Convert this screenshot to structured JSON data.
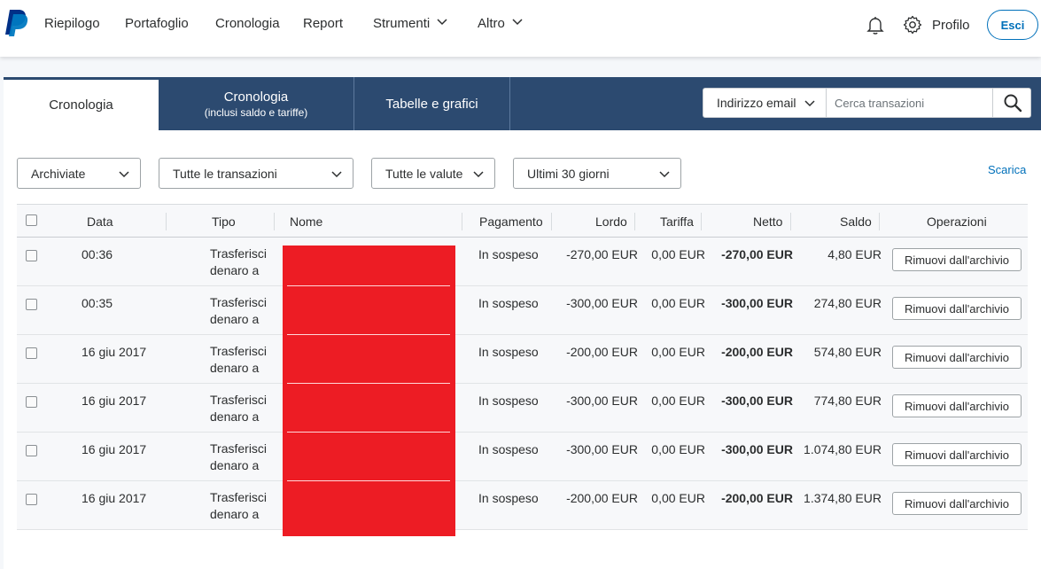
{
  "nav": {
    "items": [
      {
        "label": "Riepilogo"
      },
      {
        "label": "Portafoglio"
      },
      {
        "label": "Cronologia"
      },
      {
        "label": "Report"
      },
      {
        "label": "Strumenti"
      },
      {
        "label": "Altro"
      }
    ],
    "profile_label": "Profilo",
    "logout_label": "Esci"
  },
  "tabs": [
    {
      "label": "Cronologia",
      "sublabel": ""
    },
    {
      "label": "Cronologia",
      "sublabel": "(inclusi saldo e tariffe)"
    },
    {
      "label": "Tabelle e grafici",
      "sublabel": ""
    }
  ],
  "search": {
    "type_selected": "Indirizzo email",
    "placeholder": "Cerca transazioni"
  },
  "filters": {
    "archive": "Archiviate",
    "transactions": "Tutte le transazioni",
    "currencies": "Tutte le valute",
    "period": "Ultimi 30 giorni"
  },
  "download_label": "Scarica",
  "table": {
    "headers": {
      "data": "Data",
      "tipo": "Tipo",
      "nome": "Nome",
      "pagamento": "Pagamento",
      "lordo": "Lordo",
      "tariffa": "Tariffa",
      "netto": "Netto",
      "saldo": "Saldo",
      "operazioni": "Operazioni"
    },
    "rows": [
      {
        "date": "00:36",
        "type_line1": "Trasferisci",
        "type_line2": "denaro a",
        "payment": "In sospeso",
        "gross": "-270,00 EUR",
        "fee": "0,00 EUR",
        "net": "-270,00 EUR",
        "balance": "4,80 EUR",
        "action": "Rimuovi dall'archivio"
      },
      {
        "date": "00:35",
        "type_line1": "Trasferisci",
        "type_line2": "denaro a",
        "payment": "In sospeso",
        "gross": "-300,00 EUR",
        "fee": "0,00 EUR",
        "net": "-300,00 EUR",
        "balance": "274,80 EUR",
        "action": "Rimuovi dall'archivio"
      },
      {
        "date": "16 giu 2017",
        "type_line1": "Trasferisci",
        "type_line2": "denaro a",
        "payment": "In sospeso",
        "gross": "-200,00 EUR",
        "fee": "0,00 EUR",
        "net": "-200,00 EUR",
        "balance": "574,80 EUR",
        "action": "Rimuovi dall'archivio"
      },
      {
        "date": "16 giu 2017",
        "type_line1": "Trasferisci",
        "type_line2": "denaro a",
        "payment": "In sospeso",
        "gross": "-300,00 EUR",
        "fee": "0,00 EUR",
        "net": "-300,00 EUR",
        "balance": "774,80 EUR",
        "action": "Rimuovi dall'archivio"
      },
      {
        "date": "16 giu 2017",
        "type_line1": "Trasferisci",
        "type_line2": "denaro a",
        "payment": "In sospeso",
        "gross": "-300,00 EUR",
        "fee": "0,00 EUR",
        "net": "-300,00 EUR",
        "balance": "1.074,80 EUR",
        "action": "Rimuovi dall'archivio"
      },
      {
        "date": "16 giu 2017",
        "type_line1": "Trasferisci",
        "type_line2": "denaro a",
        "payment": "In sospeso",
        "gross": "-200,00 EUR",
        "fee": "0,00 EUR",
        "net": "-200,00 EUR",
        "balance": "1.374,80 EUR",
        "action": "Rimuovi dall'archivio"
      }
    ]
  },
  "colors": {
    "brand_blue": "#0070ba",
    "tab_bar": "#2c4a70",
    "redaction": "#ed1c24"
  },
  "icons": {
    "logo": "paypal-logo-icon",
    "notifications": "bell-icon",
    "settings": "gear-icon",
    "search": "search-icon",
    "dropdown": "chevron-down-icon"
  }
}
